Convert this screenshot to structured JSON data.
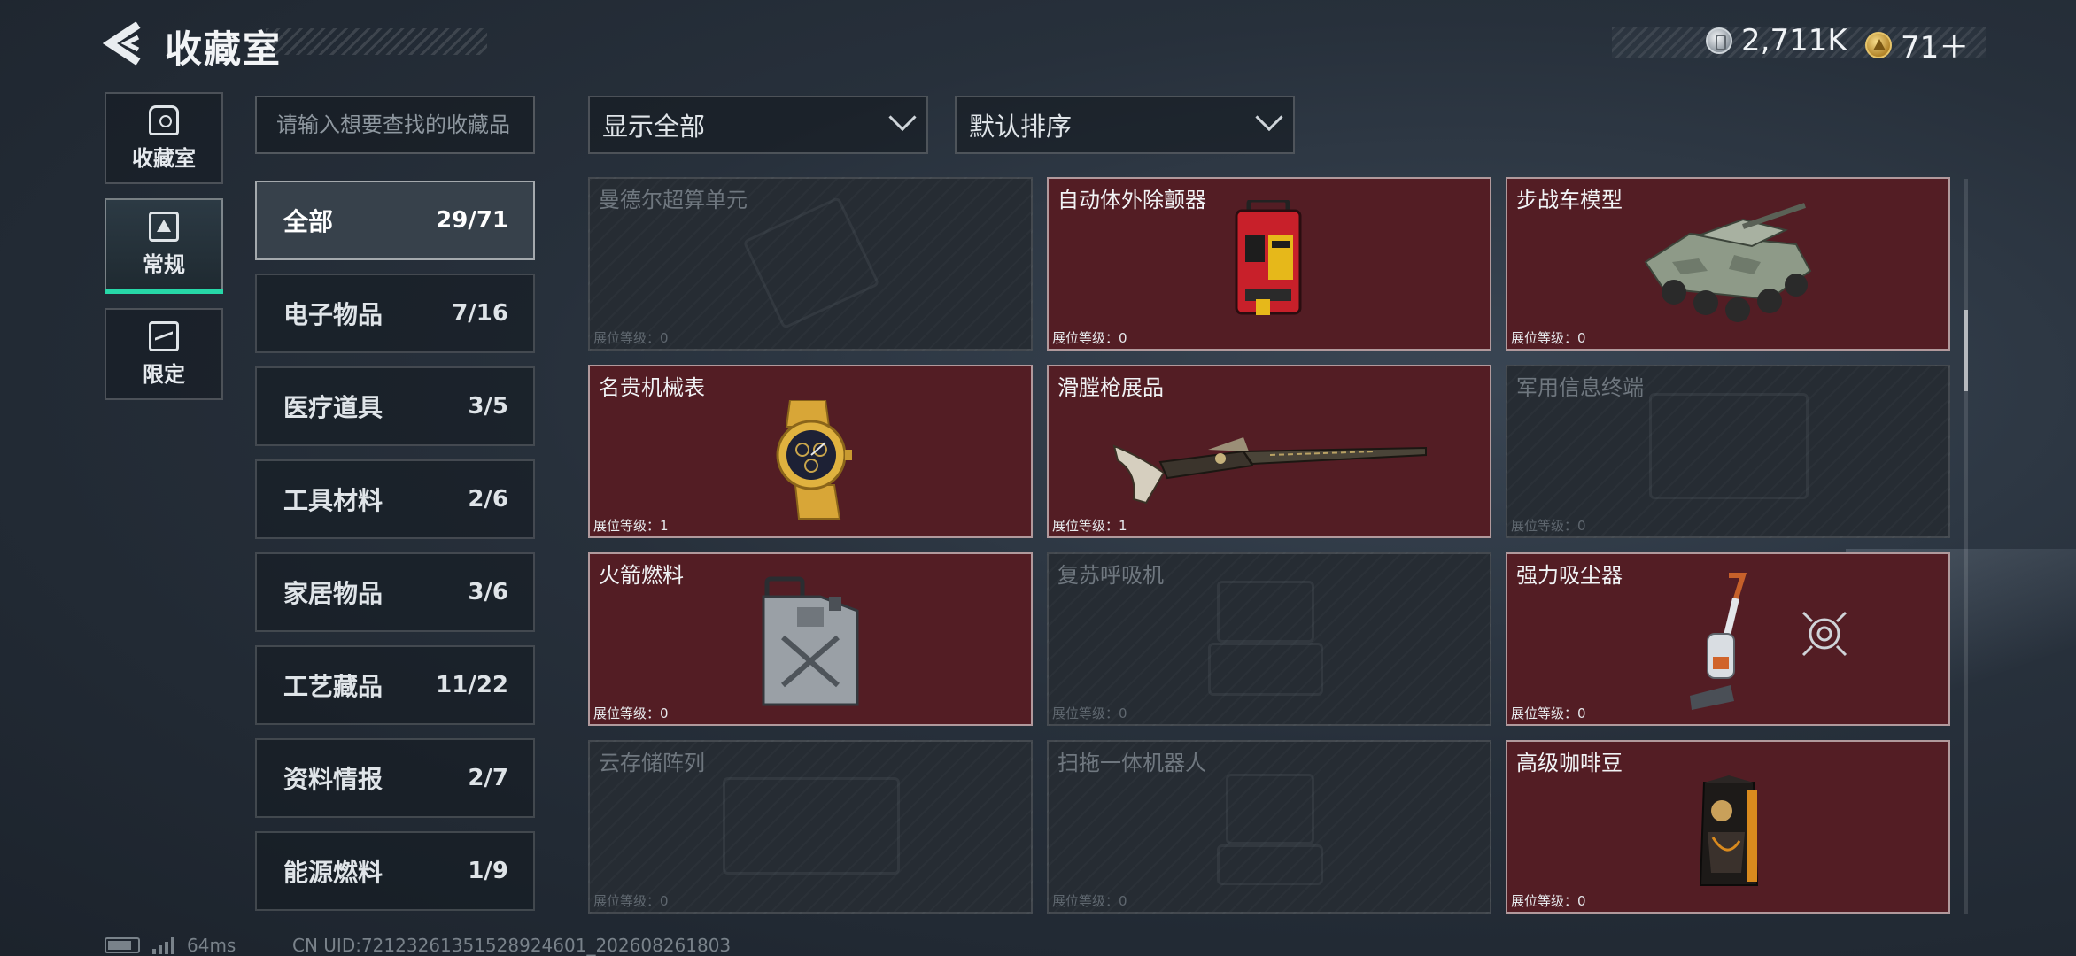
{
  "header": {
    "title": "收藏室",
    "currency_silver": "2,711K",
    "currency_gold": "71＋"
  },
  "nav": {
    "tabs": [
      {
        "label": "收藏室",
        "icon": "collection-room-icon"
      },
      {
        "label": "常规",
        "icon": "normal-icon",
        "active": true
      },
      {
        "label": "限定",
        "icon": "limited-icon"
      }
    ]
  },
  "search": {
    "placeholder": "请输入想要查找的收藏品"
  },
  "filters": {
    "display": "显示全部",
    "sort": "默认排序"
  },
  "categories": [
    {
      "label": "全部",
      "count": "29/71",
      "active": true
    },
    {
      "label": "电子物品",
      "count": "7/16"
    },
    {
      "label": "医疗道具",
      "count": "3/5"
    },
    {
      "label": "工具材料",
      "count": "2/6"
    },
    {
      "label": "家居物品",
      "count": "3/6"
    },
    {
      "label": "工艺藏品",
      "count": "11/22"
    },
    {
      "label": "资料情报",
      "count": "2/7"
    },
    {
      "label": "能源燃料",
      "count": "1/9"
    }
  ],
  "items": [
    {
      "name": "曼德尔超算单元",
      "level": "展位等级：0",
      "owned": false
    },
    {
      "name": "自动体外除颤器",
      "level": "展位等级：0",
      "owned": true
    },
    {
      "name": "步战车模型",
      "level": "展位等级：0",
      "owned": true
    },
    {
      "name": "名贵机械表",
      "level": "展位等级：1",
      "owned": true
    },
    {
      "name": "滑膛枪展品",
      "level": "展位等级：1",
      "owned": true
    },
    {
      "name": "军用信息终端",
      "level": "展位等级：0",
      "owned": false
    },
    {
      "name": "火箭燃料",
      "level": "展位等级：0",
      "owned": true
    },
    {
      "name": "复苏呼吸机",
      "level": "展位等级：0",
      "owned": false
    },
    {
      "name": "强力吸尘器",
      "level": "展位等级：0",
      "owned": true
    },
    {
      "name": "云存储阵列",
      "level": "展位等级：0",
      "owned": false
    },
    {
      "name": "扫拖一体机器人",
      "level": "展位等级：0",
      "owned": false
    },
    {
      "name": "高级咖啡豆",
      "level": "展位等级：0",
      "owned": true
    }
  ],
  "status": {
    "ping": "64ms",
    "uid": "CN UID:72123261351528924601_202608261803"
  },
  "colors": {
    "owned_card": "#531d24",
    "locked_card": "#262c33",
    "accent": "#27d7a8"
  }
}
